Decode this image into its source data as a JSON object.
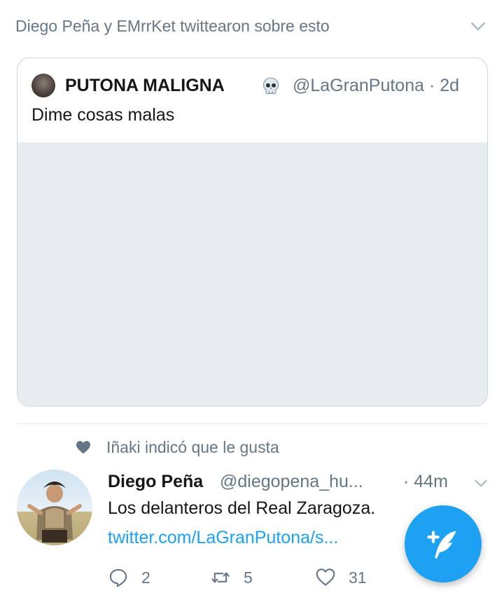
{
  "context_header": {
    "text": "Diego Peña y EMrrKet twittearon sobre esto"
  },
  "quoted_tweet": {
    "display_name": "PUTONA MALIGNA",
    "name_emoji": "skull-emoji",
    "handle_time": "@LaGranPutona · 2d",
    "text": "Dime cosas malas"
  },
  "tweet": {
    "social_context": "Iñaki indicó que le gusta",
    "display_name": "Diego Peña",
    "handle": "@diegopena_hu...",
    "time": "· 44m",
    "text": "Los delanteros del Real Zaragoza.",
    "link": "twitter.com/LaGranPutona/s...",
    "actions": {
      "replies": "2",
      "retweets": "5",
      "likes": "31"
    }
  },
  "colors": {
    "accent": "#1da1f2",
    "secondary_text": "#657786",
    "border": "#ccd6dd"
  }
}
